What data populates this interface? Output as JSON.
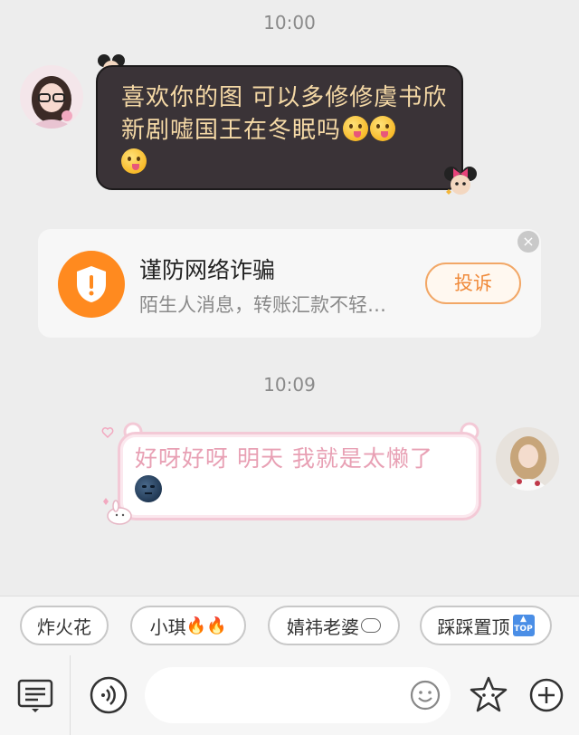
{
  "messages": {
    "time1": "10:00",
    "incoming_text": "喜欢你的图 可以多修修虞书欣新剧嘘国王在冬眠吗",
    "time2": "10:09",
    "outgoing_text": "好呀好呀 明天 我就是太懒了"
  },
  "warning": {
    "title": "谨防网络诈骗",
    "subtitle": "陌生人消息，转账汇款不轻…",
    "complain_label": "投诉",
    "close_symbol": "×",
    "accent_color": "#ff8a1f"
  },
  "quick_replies": [
    {
      "label": "炸火花",
      "icon": ""
    },
    {
      "label": "小琪",
      "icon": "fire-icon"
    },
    {
      "label": "婧祎老婆",
      "icon": "sheep-icon"
    },
    {
      "label": "踩踩置顶",
      "icon": "top-badge-icon"
    }
  ],
  "toolbar": {
    "icons": [
      "chat-menu-icon",
      "voice-icon",
      "emoji-icon",
      "star-face-icon",
      "plus-icon"
    ],
    "top_badge_text": "TOP"
  }
}
